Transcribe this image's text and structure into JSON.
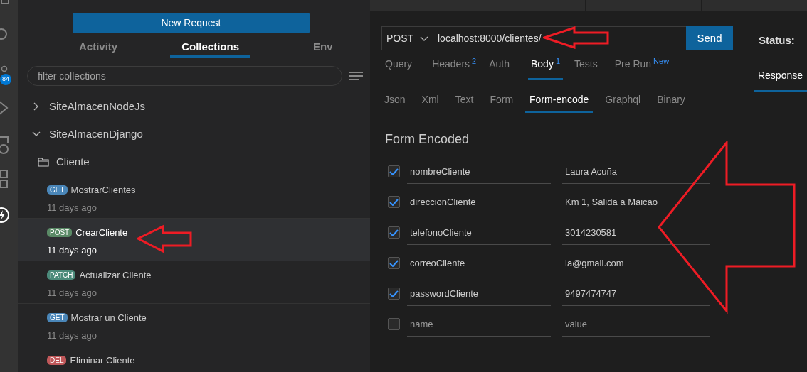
{
  "activity_bar": {
    "badge": "84"
  },
  "sidebar": {
    "new_request_button": "New Request",
    "tabs": [
      {
        "label": "Activity",
        "selected": false
      },
      {
        "label": "Collections",
        "selected": true
      },
      {
        "label": "Env",
        "selected": false
      }
    ],
    "filter": {
      "placeholder": "filter collections"
    },
    "collections": [
      {
        "name": "SiteAlmacenNodeJs",
        "expanded": false
      },
      {
        "name": "SiteAlmacenDjango",
        "expanded": true,
        "children": [
          {
            "kind": "folder",
            "name": "Cliente"
          }
        ]
      }
    ],
    "requests": [
      {
        "method": "GET",
        "color": "#4a86b8",
        "name": "MostrarClientes",
        "time": "11 days ago",
        "selected": false
      },
      {
        "method": "POST",
        "color": "#5a8a66",
        "name": "CrearCliente",
        "time": "11 days ago",
        "selected": true
      },
      {
        "method": "PATCH",
        "color": "#4b8a7a",
        "name": "Actualizar Cliente",
        "time": "11 days ago",
        "selected": false
      },
      {
        "method": "GET",
        "color": "#4a86b8",
        "name": "Mostrar un Cliente",
        "time": "11 days ago",
        "selected": false
      },
      {
        "method": "DEL",
        "color": "#c0585a",
        "name": "Eliminar Cliente",
        "selected": false
      }
    ]
  },
  "request": {
    "method": "POST",
    "url": "localhost:8000/clientes/",
    "send_button": "Send",
    "tabs": [
      {
        "label": "Query",
        "selected": false
      },
      {
        "label": "Headers",
        "sup": "2",
        "selected": false
      },
      {
        "label": "Auth",
        "selected": false
      },
      {
        "label": "Body",
        "sup": "1",
        "selected": true
      },
      {
        "label": "Tests",
        "selected": false
      },
      {
        "label": "Pre Run",
        "sup": "New",
        "selected": false
      }
    ],
    "body_tabs": [
      {
        "label": "Json",
        "selected": false
      },
      {
        "label": "Xml",
        "selected": false
      },
      {
        "label": "Text",
        "selected": false
      },
      {
        "label": "Form",
        "selected": false
      },
      {
        "label": "Form-encode",
        "selected": true
      },
      {
        "label": "Graphql",
        "selected": false
      },
      {
        "label": "Binary",
        "selected": false
      }
    ],
    "form_title": "Form Encoded",
    "fields": [
      {
        "checked": true,
        "name": "nombreCliente",
        "value": "Laura Acuña"
      },
      {
        "checked": true,
        "name": "direccionCliente",
        "value": "Km 1, Salida a Maicao"
      },
      {
        "checked": true,
        "name": "telefonoCliente",
        "value": "3014230581"
      },
      {
        "checked": true,
        "name": "correoCliente",
        "value": "la@gmail.com"
      },
      {
        "checked": true,
        "name": "passwordCliente",
        "value": "9497474747"
      },
      {
        "checked": false,
        "name_placeholder": "name",
        "value_placeholder": "value"
      }
    ]
  },
  "response": {
    "status_label": "Status:",
    "tabs": [
      {
        "label": "Response",
        "selected": true
      }
    ]
  }
}
